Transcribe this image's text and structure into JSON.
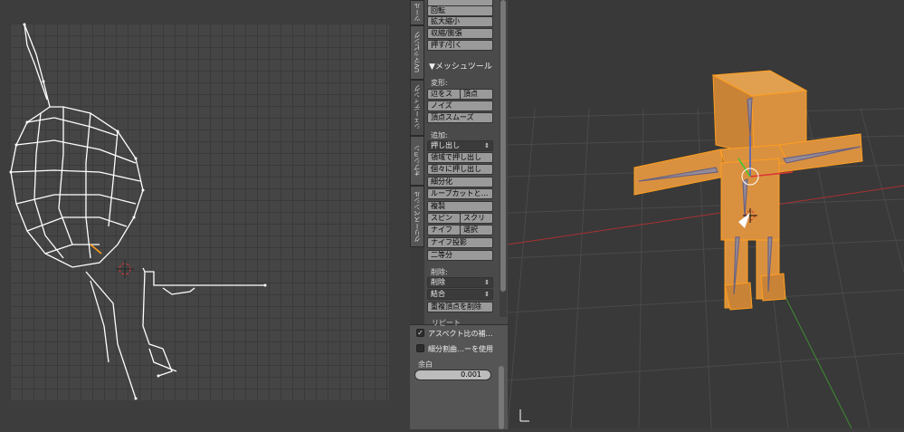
{
  "tool_shelf": {
    "tabs": [
      "ツール",
      "UVマッピング",
      "シェーディング",
      "オプション",
      "グリースペンシル"
    ],
    "transform_buttons": [
      "回転",
      "拡大縮小",
      "収縮/膨張",
      "押す/引く"
    ],
    "mesh_tools": {
      "header": "▼メッシュツール",
      "deform_label": "変形:",
      "deform_row1": [
        "辺をス",
        "頂点"
      ],
      "deform_buttons": [
        "ノイズ",
        "頂点スムーズ"
      ],
      "add_label": "追加:",
      "extrude_select": "押し出し",
      "add_buttons": [
        "領域で押し出し",
        "個々に押し出し",
        "細分化",
        "ループカットと…",
        "複製"
      ],
      "spin_row": [
        "スピン",
        "スクリ"
      ],
      "knife_row": [
        "ナイフ",
        "選択"
      ],
      "add_buttons2": [
        "ナイフ投影",
        "二等分"
      ],
      "remove_label": "削除:",
      "delete_select": "削除",
      "merge_select": "結合",
      "remove_doubles": "重複頂点を削除"
    },
    "lower": {
      "cut_header": "リピート",
      "aspect_label": "アスペクト比の補…",
      "aspect_checked": true,
      "subsurf_label": "細分割曲…ーを使用",
      "subsurf_checked": false,
      "margin_label": "余白",
      "margin_value": "0.001"
    }
  },
  "icons": [
    "checkmark-icon",
    "dropdown-arrows-icon",
    "3d-cursor-icon",
    "transform-gizmo-icon"
  ],
  "colors": {
    "mesh_face": "#d9913f",
    "mesh_edge": "#ff9e1f",
    "x_axis": "#a83232",
    "y_axis": "#3f8c32",
    "uv_lines": "#ffffff"
  }
}
